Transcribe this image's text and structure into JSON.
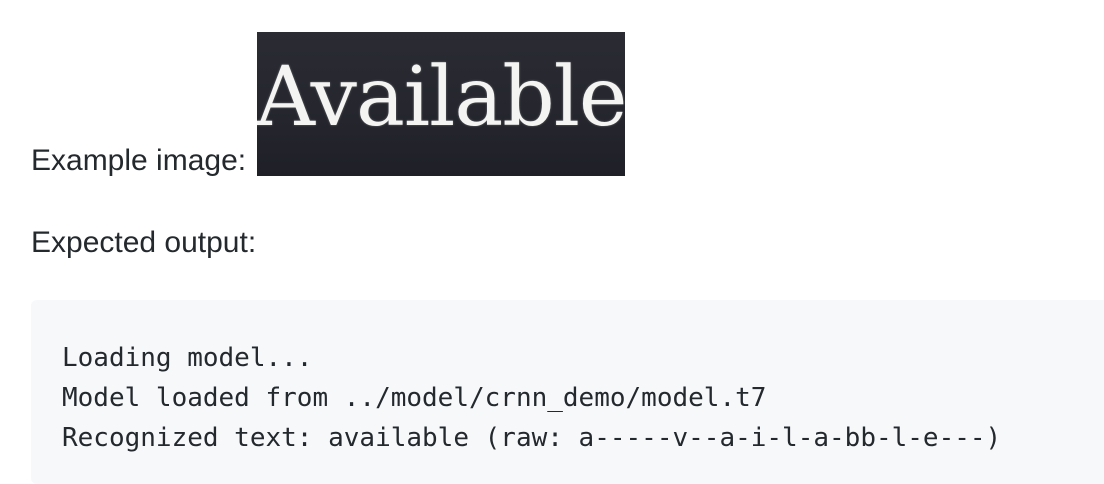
{
  "example": {
    "label": "Example image:",
    "image_text": "Available"
  },
  "expected": {
    "label": "Expected output:"
  },
  "code": {
    "lines": [
      "Loading model...",
      "Model loaded from ../model/crnn_demo/model.t7",
      "Recognized text: available (raw: a-----v--a-i-l-a-bb-l-e---)"
    ]
  }
}
